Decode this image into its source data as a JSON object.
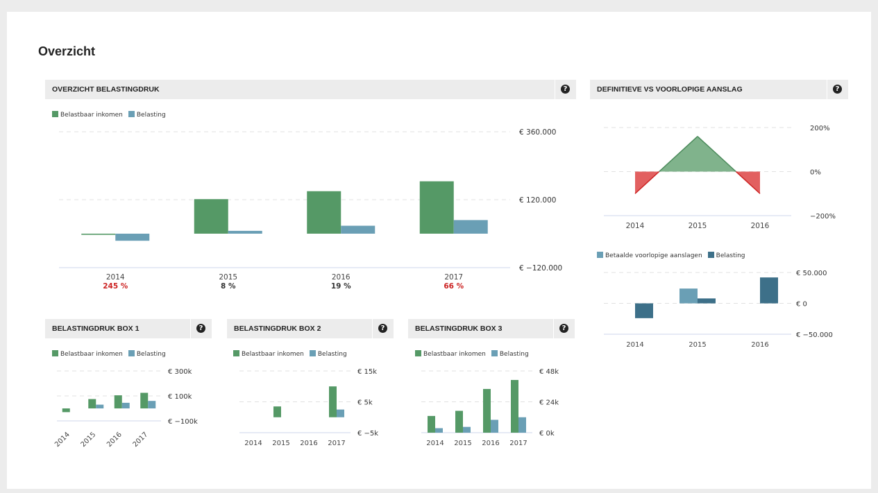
{
  "page": {
    "title": "Overzicht"
  },
  "colors": {
    "green": "#559966",
    "blue": "#6a9fb5",
    "darkblue": "#3d7089",
    "red": "#dd4444",
    "negative_label": "#cc2222"
  },
  "panels": {
    "main": {
      "title": "OVERZICHT BELASTINGDRUK",
      "help_icon": "question-circle-icon"
    },
    "compare": {
      "title": "DEFINITIEVE VS VOORLOPIGE AANSLAG",
      "help_icon": "question-circle-icon"
    },
    "box1": {
      "title": "BELASTINGDRUK BOX 1",
      "help_icon": "question-circle-icon"
    },
    "box2": {
      "title": "BELASTINGDRUK BOX 2",
      "help_icon": "question-circle-icon"
    },
    "box3": {
      "title": "BELASTINGDRUK BOX 3",
      "help_icon": "question-circle-icon"
    }
  },
  "chart_data": [
    {
      "id": "main",
      "type": "bar",
      "title": "OVERZICHT BELASTINGDRUK",
      "categories": [
        "2014",
        "2015",
        "2016",
        "2017"
      ],
      "series": [
        {
          "name": "Belastbaar inkomen",
          "color": "#559966",
          "values": [
            -4000,
            122000,
            150000,
            185000
          ]
        },
        {
          "name": "Belasting",
          "color": "#6a9fb5",
          "values": [
            -25000,
            10000,
            28000,
            48000
          ]
        }
      ],
      "ylim": [
        -120000,
        360000
      ],
      "yticks": [
        -120000,
        120000,
        360000
      ],
      "ytick_labels": [
        "€ −120.000",
        "€ 120.000",
        "€ 360.000"
      ],
      "sublabels": [
        "245 %",
        "8 %",
        "19 %",
        "66 %"
      ],
      "sublabel_highlight": [
        true,
        false,
        false,
        true
      ],
      "legend_position": "top-left",
      "grid": true
    },
    {
      "id": "compare",
      "type": "area",
      "title": "DEFINITIEVE VS VOORLOPIGE AANSLAG",
      "categories": [
        "2014",
        "2015",
        "2016"
      ],
      "values": [
        -100,
        160,
        -100
      ],
      "ylim": [
        -200,
        200
      ],
      "yticks": [
        -200,
        0,
        200
      ],
      "ytick_labels": [
        "−200%",
        "0%",
        "200%"
      ],
      "grid": true
    },
    {
      "id": "compare_bars",
      "type": "bar",
      "categories": [
        "2014",
        "2015",
        "2016"
      ],
      "series": [
        {
          "name": "Betaalde voorlopige aanslagen",
          "color": "#6a9fb5",
          "values": [
            0,
            24000,
            0
          ]
        },
        {
          "name": "Belasting",
          "color": "#3d7089",
          "values": [
            -24000,
            8000,
            42000
          ]
        }
      ],
      "ylim": [
        -50000,
        50000
      ],
      "yticks": [
        -50000,
        0,
        50000
      ],
      "ytick_labels": [
        "€ −50.000",
        "€ 0",
        "€ 50.000"
      ],
      "legend_position": "top-left",
      "grid": true
    },
    {
      "id": "box1",
      "type": "bar",
      "title": "BELASTINGDRUK BOX 1",
      "categories": [
        "2014",
        "2015",
        "2016",
        "2017"
      ],
      "series": [
        {
          "name": "Belastbaar inkomen",
          "color": "#559966",
          "values": [
            -30000,
            75000,
            105000,
            125000
          ]
        },
        {
          "name": "Belasting",
          "color": "#6a9fb5",
          "values": [
            0,
            30000,
            45000,
            60000
          ]
        }
      ],
      "ylim": [
        -100000,
        300000
      ],
      "yticks": [
        -100000,
        100000,
        300000
      ],
      "ytick_labels": [
        "€ −100k",
        "€ 100k",
        "€ 300k"
      ],
      "rotated_ticks": true,
      "legend_position": "top-left",
      "grid": true
    },
    {
      "id": "box2",
      "type": "bar",
      "title": "BELASTINGDRUK BOX 2",
      "categories": [
        "2014",
        "2015",
        "2016",
        "2017"
      ],
      "series": [
        {
          "name": "Belastbaar inkomen",
          "color": "#559966",
          "values": [
            0,
            3500,
            0,
            10000
          ]
        },
        {
          "name": "Belasting",
          "color": "#6a9fb5",
          "values": [
            0,
            0,
            0,
            2500
          ]
        }
      ],
      "ylim": [
        -5000,
        15000
      ],
      "yticks": [
        -5000,
        5000,
        15000
      ],
      "ytick_labels": [
        "€ −5k",
        "€ 5k",
        "€ 15k"
      ],
      "legend_position": "top-left",
      "grid": true
    },
    {
      "id": "box3",
      "type": "bar",
      "title": "BELASTINGDRUK BOX 3",
      "categories": [
        "2014",
        "2015",
        "2016",
        "2017"
      ],
      "series": [
        {
          "name": "Belastbaar inkomen",
          "color": "#559966",
          "values": [
            13000,
            17000,
            34000,
            41000
          ]
        },
        {
          "name": "Belasting",
          "color": "#6a9fb5",
          "values": [
            3500,
            4500,
            10000,
            12000
          ]
        }
      ],
      "ylim": [
        0,
        48000
      ],
      "yticks": [
        0,
        24000,
        48000
      ],
      "ytick_labels": [
        "€ 0k",
        "€ 24k",
        "€ 48k"
      ],
      "legend_position": "top-left",
      "grid": true
    }
  ]
}
